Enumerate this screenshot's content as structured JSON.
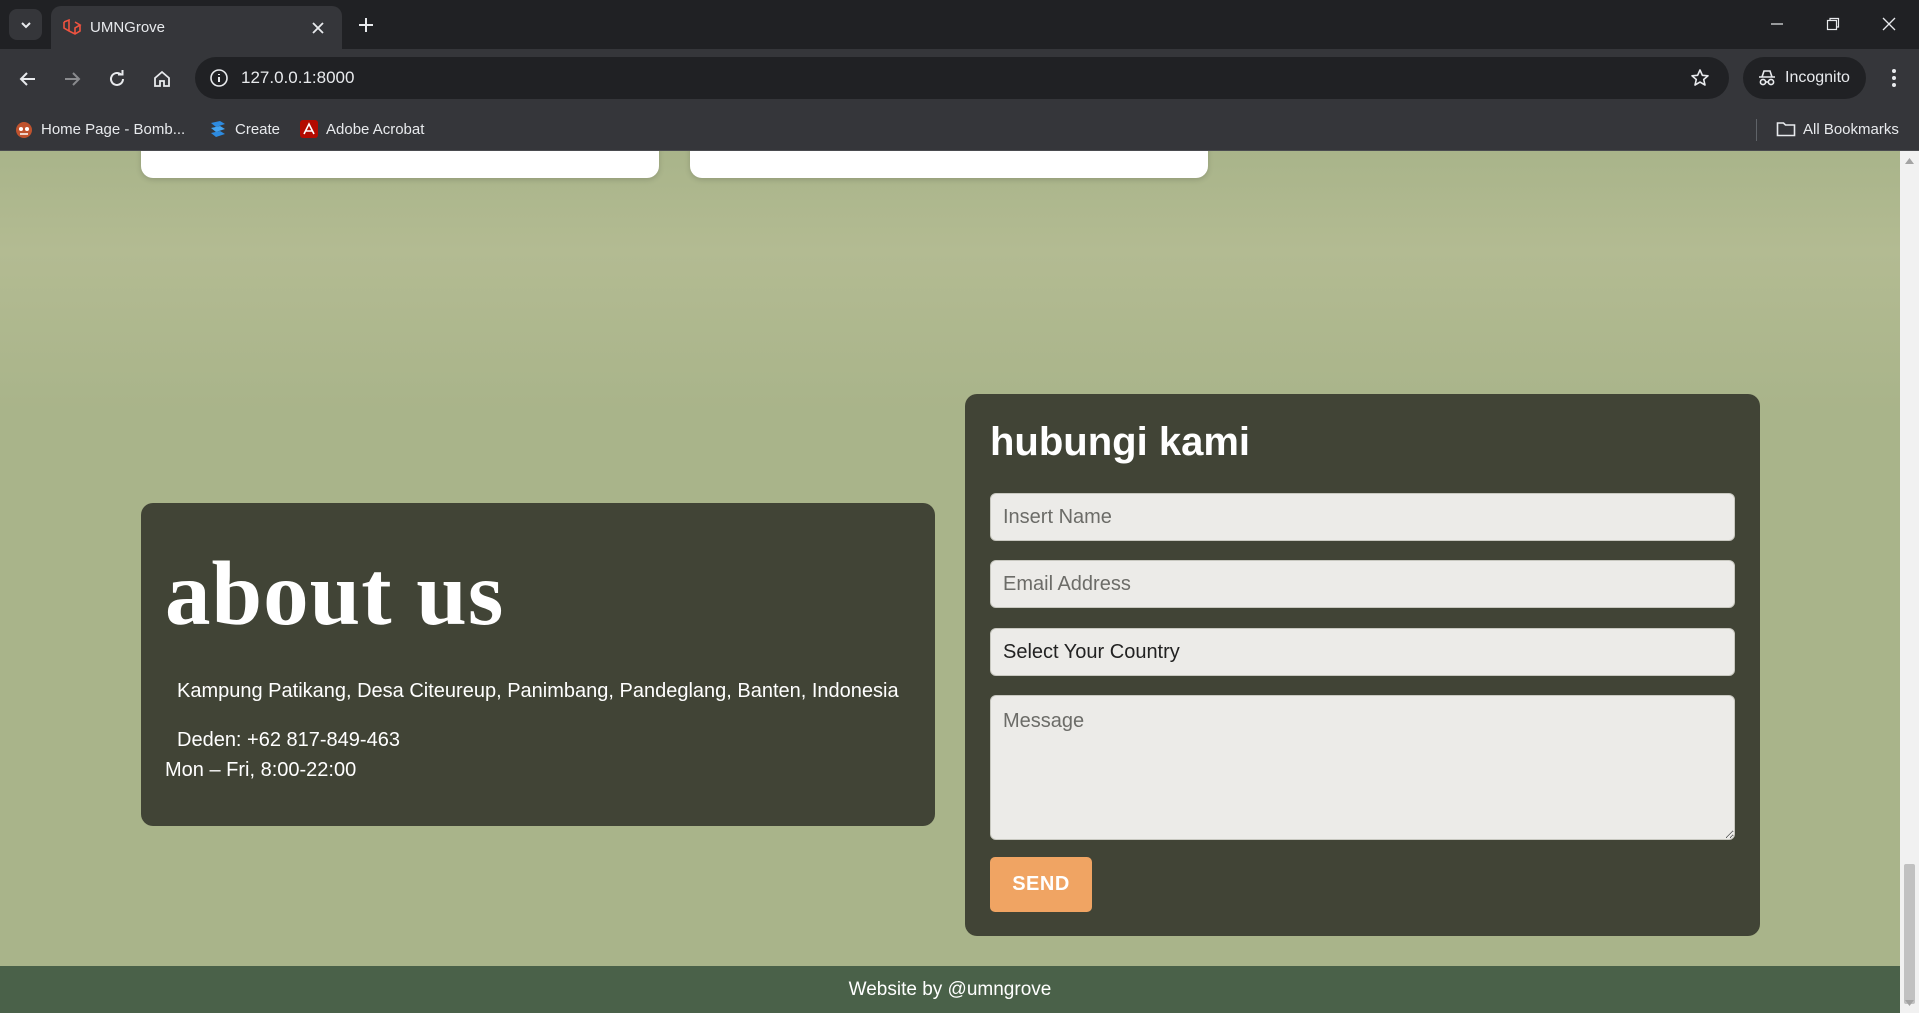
{
  "browser": {
    "tab_title": "UMNGrove",
    "url": "127.0.0.1:8000",
    "incognito_label": "Incognito",
    "bookmarks": [
      {
        "label": "Home Page - Bomb...",
        "icon": "bomb-favicon-icon"
      },
      {
        "label": "Create",
        "icon": "create-favicon-icon"
      },
      {
        "label": "Adobe Acrobat",
        "icon": "acrobat-icon"
      }
    ],
    "all_bookmarks_label": "All Bookmarks"
  },
  "about": {
    "title": "about us",
    "address": "Kampung Patikang, Desa Citeureup, Panimbang, Pandeglang, Banten, Indonesia",
    "phone": "Deden: +62 817-849-463",
    "hours": "Mon – Fri, 8:00-22:00"
  },
  "contact": {
    "title": "hubungi kami",
    "name_placeholder": "Insert Name",
    "email_placeholder": "Email Address",
    "country_value": "Select Your Country",
    "message_placeholder": "Message",
    "send_label": "SEND"
  },
  "footer": {
    "text": "Website by @umngrove"
  },
  "colors": {
    "page_bg": "#a9b48a",
    "card_bg": "#414436",
    "send_button": "#f0a463",
    "footer_bg": "#4a6149"
  }
}
